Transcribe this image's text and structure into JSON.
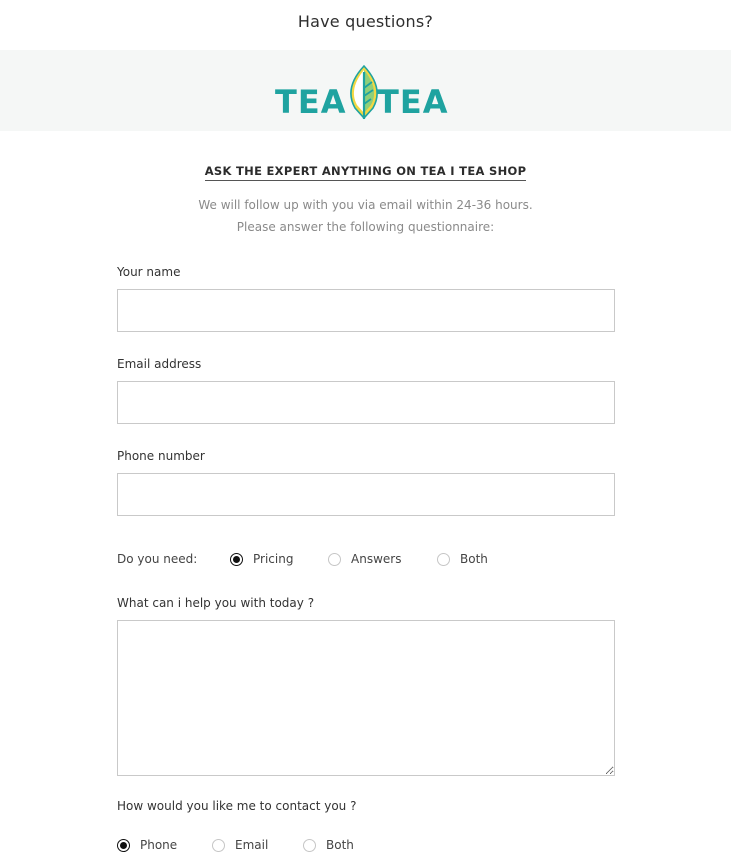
{
  "header": {
    "title": "Have questions?"
  },
  "logo": {
    "left_word": "TEA",
    "right_word": "TEA",
    "brand_color": "#1fa3a0",
    "leaf_accent": "#f2d843"
  },
  "form": {
    "heading": "ASK THE EXPERT ANYTHING ON TEA I TEA SHOP",
    "intro_line1": "We will follow up with you via email within 24-36 hours.",
    "intro_line2": "Please answer the following questionnaire:",
    "name": {
      "label": "Your name",
      "value": ""
    },
    "email": {
      "label": "Email address",
      "value": ""
    },
    "phone": {
      "label": "Phone number",
      "value": ""
    },
    "need": {
      "label": "Do you need:",
      "options": [
        "Pricing",
        "Answers",
        "Both"
      ],
      "selected": "Pricing"
    },
    "help": {
      "label": "What can i help you with today ?",
      "value": ""
    },
    "contact": {
      "label": "How would you like me to contact you ?",
      "options": [
        "Phone",
        "Email",
        "Both"
      ],
      "selected": "Phone"
    }
  }
}
